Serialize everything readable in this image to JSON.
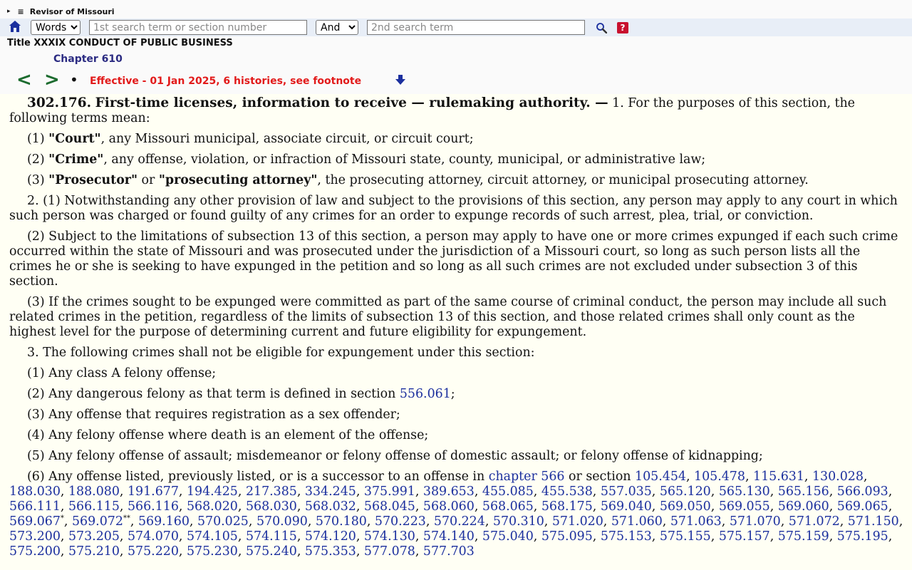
{
  "site": {
    "title": "Revisor of Missouri",
    "expand_glyph": "▸",
    "menu_glyph": "≡"
  },
  "search": {
    "mode_options": [
      "Words"
    ],
    "mode_selected": "Words",
    "term1_placeholder": "1st search term or section number",
    "bool_options": [
      "And"
    ],
    "bool_selected": "And",
    "term2_placeholder": "2nd search term",
    "help_label": "?"
  },
  "breadcrumb": {
    "title": "Title XXXIX CONDUCT OF PUBLIC BUSINESS",
    "chapter": "Chapter 610"
  },
  "nav": {
    "prev": "<",
    "next": ">",
    "bullet": "•",
    "effective": "Effective - 01 Jan 2025, 6 histories, see footnote"
  },
  "colors": {
    "accent_blue": "#1b2f9e",
    "chapter_blue": "#2b2b82",
    "effective_red": "#e21a1a",
    "nav_green": "#1c6b2e",
    "page_background": "#fffff4"
  },
  "section": {
    "number": "302.176.",
    "catchline": "First-time licenses, information to receive — rulemaking authority. —",
    "intro": " 1.  For the purposes of this section, the following terms mean:",
    "def1": {
      "num": "(1) ",
      "term": "\"Court\"",
      "text": ", any Missouri municipal, associate circuit, or circuit court;"
    },
    "def2": {
      "num": "(2) ",
      "term": "\"Crime\"",
      "text": ", any offense, violation, or infraction of Missouri state, county, municipal, or administrative law;"
    },
    "def3": {
      "num": "(3) ",
      "term_a": "\"Prosecutor\"",
      "mid": " or ",
      "term_b": "\"prosecuting attorney\"",
      "text": ", the prosecuting attorney, circuit attorney, or municipal prosecuting attorney."
    },
    "p2_1": "2.  (1)  Notwithstanding any other provision of law and subject to the provisions of this section, any person may apply to any court in which such person was charged or found guilty of any crimes for an order to expunge records of such arrest, plea, trial, or conviction.",
    "p2_2": "(2)  Subject to the limitations of subsection 13 of this section, a person may apply to have one or more crimes expunged if each such crime occurred within the state of Missouri and was prosecuted under the jurisdiction of a Missouri court, so long as such person lists all the crimes he or she is seeking to have expunged in the petition and so long as all such crimes are not excluded under subsection 3 of this section.",
    "p2_3": "(3)  If the crimes sought to be expunged were committed as part of the same course of criminal conduct, the person may include all such related crimes in the petition, regardless of the limits of subsection 13 of this section, and those related crimes shall only count as the highest level for the purpose of determining current and future eligibility for expungement.",
    "p3": "3.  The following crimes shall not be eligible for expungement under this section:",
    "p3_1": "(1)  Any class A felony offense;",
    "p3_2_text": "(2)  Any dangerous felony as that term is defined in section ",
    "p3_2_link": "556.061",
    "p3_2_end": ";",
    "p3_3": "(3)  Any offense that requires registration as a sex offender;",
    "p3_4": "(4)  Any felony offense where death is an element of the offense;",
    "p3_5": "(5)  Any felony offense of assault; misdemeanor or felony offense of domestic assault; or felony offense of kidnapping;",
    "p3_6_text": "(6)  Any offense listed, previously listed, or is a successor to an offense in ",
    "p3_6_chapter_link": "chapter 566",
    "p3_6_mid": " or section ",
    "p3_6_links_a": [
      "105.454",
      "105.478",
      "115.631",
      "130.028",
      "188.030",
      "188.080",
      "191.677",
      "194.425",
      "217.385",
      "334.245",
      "375.991",
      "389.653",
      "455.085",
      "455.538",
      "557.035",
      "565.120",
      "565.130",
      "565.156",
      "566.093",
      "566.111",
      "566.115",
      "566.116",
      "568.020",
      "568.030",
      "568.032",
      "568.045",
      "568.060",
      "568.065",
      "568.175",
      "569.040",
      "569.050",
      "569.055",
      "569.060",
      "569.065",
      "569.067"
    ],
    "sup_1": "*",
    "link_after_sup1": "569.072",
    "sup_2": "**",
    "p3_6_links_b": [
      "569.160",
      "570.025",
      "570.090",
      "570.180",
      "570.223",
      "570.224",
      "570.310",
      "571.020",
      "571.060",
      "571.063",
      "571.070",
      "571.072",
      "571.150",
      "573.200",
      "573.205",
      "574.070",
      "574.105",
      "574.115",
      "574.120",
      "574.130",
      "574.140",
      "575.040",
      "575.095",
      "575.153",
      "575.155",
      "575.157",
      "575.159",
      "575.195",
      "575.200",
      "575.210",
      "575.220",
      "575.230",
      "575.240",
      "575.353",
      "577.078",
      "577.703"
    ]
  }
}
